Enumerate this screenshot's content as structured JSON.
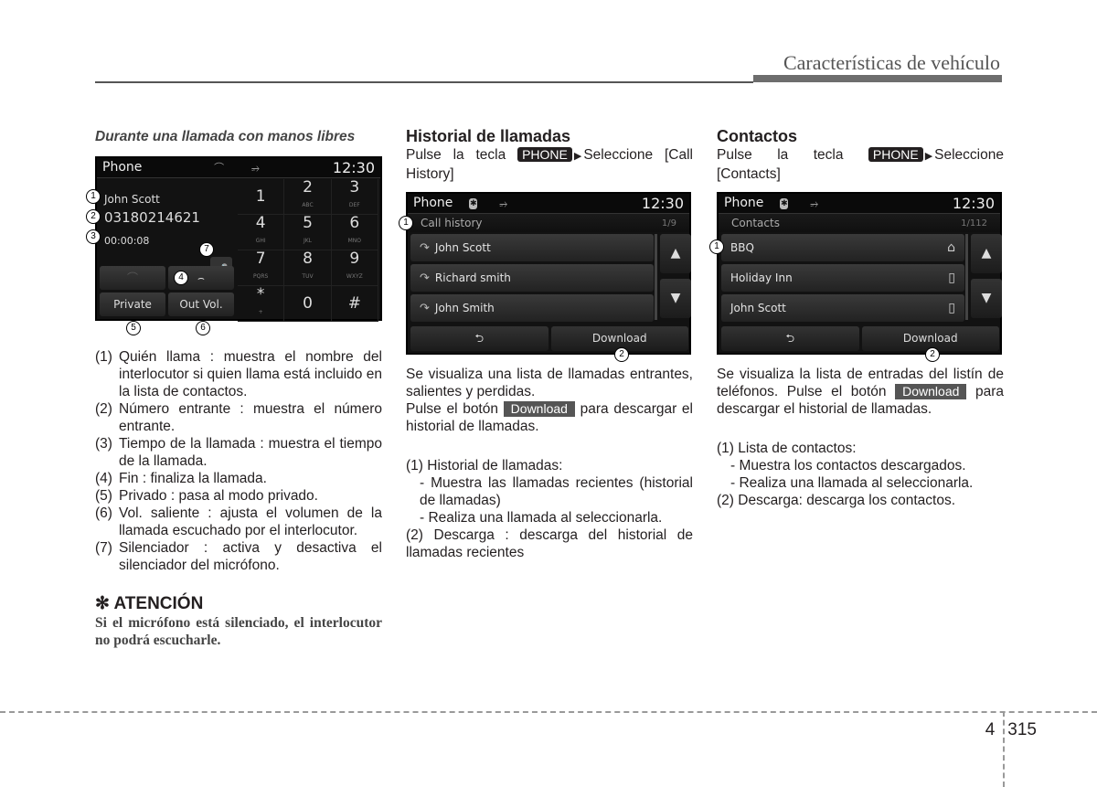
{
  "header": {
    "title": "Características de vehículo"
  },
  "col1": {
    "heading": "Durante una llamada con manos libres",
    "screen": {
      "app": "Phone",
      "clock": "12:30",
      "caller_name": "John Scott",
      "number": "03180214621",
      "duration": "00:00:08",
      "keypad": [
        {
          "d": "1",
          "l": ""
        },
        {
          "d": "2",
          "l": "ABC"
        },
        {
          "d": "3",
          "l": "DEF"
        },
        {
          "d": "4",
          "l": "GHI"
        },
        {
          "d": "5",
          "l": "JKL"
        },
        {
          "d": "6",
          "l": "MNO"
        },
        {
          "d": "7",
          "l": "PQRS"
        },
        {
          "d": "8",
          "l": "TUV"
        },
        {
          "d": "9",
          "l": "WXYZ"
        },
        {
          "d": "*",
          "l": "+"
        },
        {
          "d": "0",
          "l": ""
        },
        {
          "d": "#",
          "l": ""
        }
      ],
      "private_label": "Private",
      "outvol_label": "Out Vol.",
      "callouts": [
        "1",
        "2",
        "3",
        "4",
        "5",
        "6",
        "7"
      ]
    },
    "items": [
      {
        "n": "(1)",
        "t": "Quién llama : muestra el nombre del interlocutor si quien llama está incluido en la lista de contactos."
      },
      {
        "n": "(2)",
        "t": "Número entrante : muestra el número entrante."
      },
      {
        "n": "(3)",
        "t": "Tiempo de la llamada : muestra el tiempo de la llamada."
      },
      {
        "n": "(4)",
        "t": "Fin : finaliza la llamada."
      },
      {
        "n": "(5)",
        "t": "Privado : pasa al modo privado."
      },
      {
        "n": "(6)",
        "t": "Vol. saliente : ajusta el volumen de la llamada escuchado por el interlocutor."
      },
      {
        "n": "(7)",
        "t": "Silenciador : activa y desactiva el silenciador del micrófono."
      }
    ],
    "attention": {
      "title": "✻ ATENCIÓN",
      "body": "Si el micrófono está silenciado, el interlocutor no podrá escucharle."
    }
  },
  "col2": {
    "heading": "Historial de llamadas",
    "intro_a": "Pulse la tecla",
    "key": "PHONE",
    "intro_b": "Seleccione [Call History]",
    "screen": {
      "app": "Phone",
      "clock": "12:30",
      "subtitle": "Call history",
      "page": "1/9",
      "rows": [
        "John Scott",
        "Richard smith",
        "John Smith"
      ],
      "download": "Download",
      "callouts": [
        "1",
        "2"
      ]
    },
    "desc1": "Se visualiza una lista de llamadas entrantes, salientes y perdidas.",
    "desc2_a": "Pulse el botón",
    "desc2_btn": "Download",
    "desc2_b": "para descargar el historial de llamadas.",
    "list": {
      "i1": "(1) Historial de llamadas:",
      "s1": "- Muestra las llamadas recientes (historial de llamadas)",
      "s2": "- Realiza una llamada al seleccionarla.",
      "i2": "(2) Descarga : descarga del historial de llamadas recientes"
    }
  },
  "col3": {
    "heading": "Contactos",
    "intro_a": "Pulse la tecla",
    "key": "PHONE",
    "intro_b": "Seleccione [Contacts]",
    "screen": {
      "app": "Phone",
      "clock": "12:30",
      "subtitle": "Contacts",
      "page": "1/112",
      "rows": [
        {
          "name": "BBQ",
          "icon": "home"
        },
        {
          "name": "Holiday Inn",
          "icon": "mobile"
        },
        {
          "name": "John Scott",
          "icon": "mobile"
        }
      ],
      "download": "Download",
      "callouts": [
        "1",
        "2"
      ]
    },
    "desc_a": "Se visualiza la lista de entradas del listín de teléfonos. Pulse el botón",
    "desc_btn": "Download",
    "desc_b": "para descargar el historial de llamadas.",
    "list": {
      "i1": "(1) Lista de contactos:",
      "s1": "- Muestra los contactos descargados.",
      "s2": "- Realiza una llamada al seleccionarla.",
      "i2": "(2) Descarga: descarga los contactos."
    }
  },
  "footer": {
    "chapter": "4",
    "page": "315"
  }
}
